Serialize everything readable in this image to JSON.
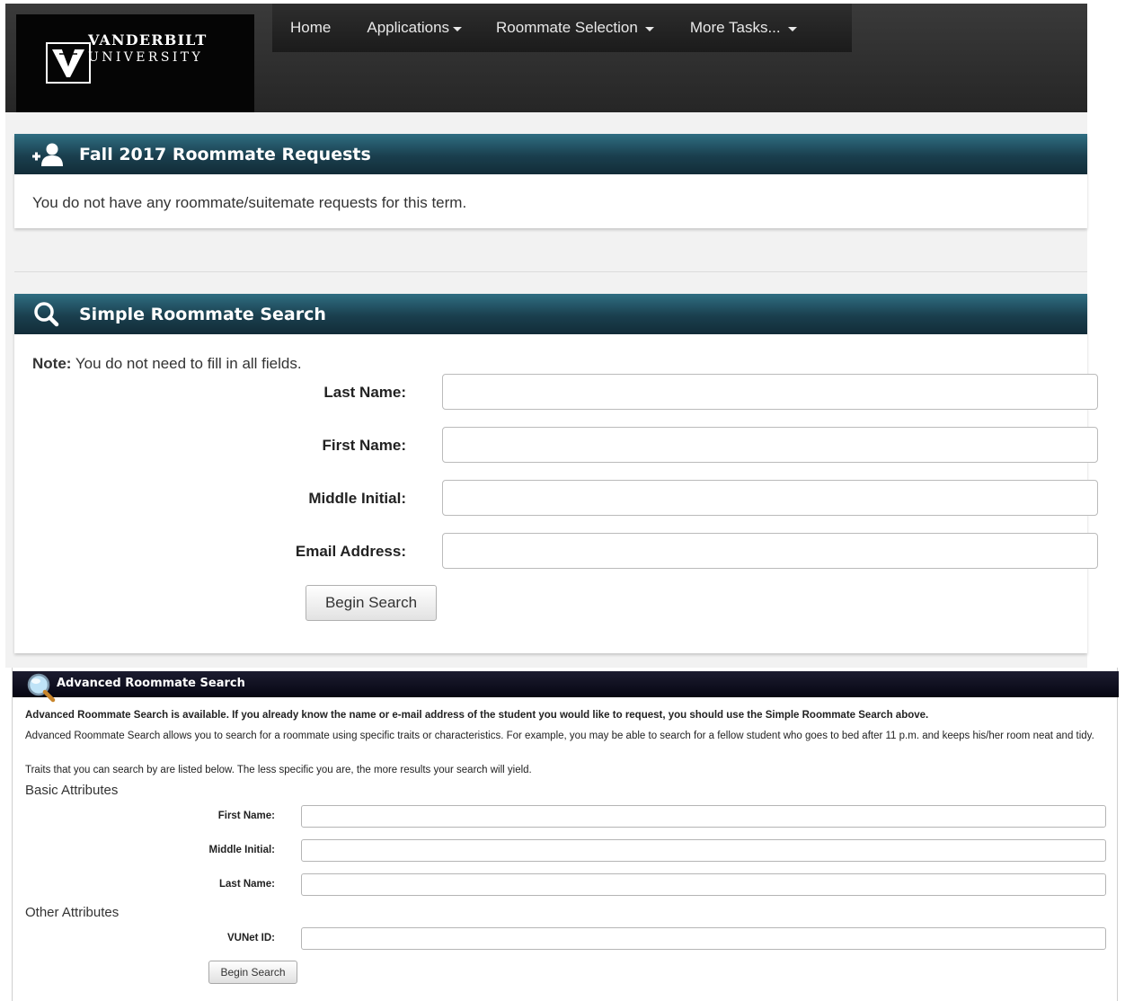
{
  "header": {
    "logo_line1": "VANDERBILT",
    "logo_line2": "UNIVERSITY",
    "nav": {
      "home": "Home",
      "applications": "Applications",
      "roommate_selection": "Roommate Selection",
      "more_tasks": "More Tasks..."
    }
  },
  "requests_panel": {
    "title": "Fall 2017 Roommate Requests",
    "message": "You do not have any roommate/suitemate requests for this term."
  },
  "simple_search": {
    "title": "Simple Roommate Search",
    "note_label": "Note:",
    "note_text": " You do not need to fill in all fields.",
    "fields": {
      "last_name": {
        "label": "Last Name:",
        "value": ""
      },
      "first_name": {
        "label": "First Name:",
        "value": ""
      },
      "middle_initial": {
        "label": "Middle Initial:",
        "value": ""
      },
      "email": {
        "label": "Email Address:",
        "value": ""
      }
    },
    "button": "Begin Search"
  },
  "advanced_search": {
    "title": "Advanced Roommate Search",
    "p1": "Advanced Roommate Search is available. If you already know the name or e-mail address of the student you would like to request, you should use the Simple Roommate Search above.",
    "p2": "Advanced Roommate Search allows you to search for a roommate using specific traits or characteristics. For example, you may be able to search for a fellow student who goes to bed after 11 p.m. and keeps his/her room neat and tidy.",
    "p3": "Traits that you can search by are listed below. The less specific you are, the more results your search will yield.",
    "basic_heading": "Basic Attributes",
    "other_heading": "Other Attributes",
    "fields": {
      "first_name": {
        "label": "First Name:",
        "value": ""
      },
      "middle_initial": {
        "label": "Middle Initial:",
        "value": ""
      },
      "last_name": {
        "label": "Last Name:",
        "value": ""
      },
      "vunet_id": {
        "label": "VUNet ID:",
        "value": ""
      }
    },
    "button": "Begin Search"
  },
  "colors": {
    "panel_header": "#1a3f4e",
    "nav_bg": "#262626",
    "advanced_header": "#060612"
  }
}
